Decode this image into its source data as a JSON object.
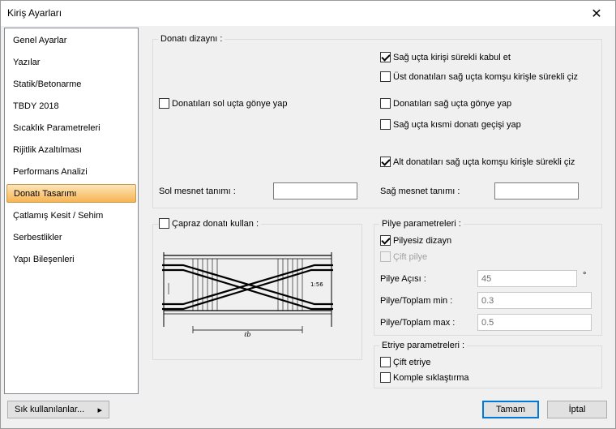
{
  "window": {
    "title": "Kiriş Ayarları"
  },
  "sidebar": {
    "items": [
      {
        "label": "Genel Ayarlar",
        "selected": false
      },
      {
        "label": "Yazılar",
        "selected": false
      },
      {
        "label": "Statik/Betonarme",
        "selected": false
      },
      {
        "label": "TBDY 2018",
        "selected": false
      },
      {
        "label": "Sıcaklık Parametreleri",
        "selected": false
      },
      {
        "label": "Rijitlik Azaltılması",
        "selected": false
      },
      {
        "label": "Performans Analizi",
        "selected": false
      },
      {
        "label": "Donatı Tasarımı",
        "selected": true
      },
      {
        "label": "Çatlamış Kesit / Sehim",
        "selected": false
      },
      {
        "label": "Serbestlikler",
        "selected": false
      },
      {
        "label": "Yapı Bileşenleri",
        "selected": false
      }
    ]
  },
  "donati_dizayni": {
    "title": "Donatı dizaynı :",
    "sag_kirisi_surekli": {
      "label": "Sağ uçta kirişi sürekli kabul et",
      "checked": true
    },
    "ust_donati_komsu": {
      "label": "Üst donatıları sağ uçta komşu kirişle sürekli çiz",
      "checked": false
    },
    "sol_gonye": {
      "label": "Donatıları sol uçta gönye yap",
      "checked": false
    },
    "sag_gonye": {
      "label": "Donatıları sağ uçta gönye yap",
      "checked": false
    },
    "sag_kismi_gecis": {
      "label": "Sağ uçta kısmi donatı geçişi yap",
      "checked": false
    },
    "alt_donati_komsu": {
      "label": "Alt donatıları sağ uçta komşu kirişle sürekli çiz",
      "checked": true
    },
    "sol_mesnet_label": "Sol mesnet tanımı :",
    "sol_mesnet_value": "",
    "sag_mesnet_label": "Sağ mesnet tanımı :",
    "sag_mesnet_value": ""
  },
  "capraz": {
    "label": "Çapraz donatı kullan :",
    "checked": false,
    "diagram_labels": {
      "angle": "1:56",
      "length": "ℓb"
    }
  },
  "pilye": {
    "title": "Pilye parametreleri :",
    "pilyesiz": {
      "label": "Pilyesiz dizayn",
      "checked": true
    },
    "cift_pilye": {
      "label": "Çift pilye",
      "checked": false,
      "disabled": true
    },
    "aci_label": "Pilye Açısı :",
    "aci_value": "45",
    "aci_unit": "°",
    "toplam_min_label": "Pilye/Toplam min :",
    "toplam_min_value": "0.3",
    "toplam_max_label": "Pilye/Toplam max :",
    "toplam_max_value": "0.5"
  },
  "etriye": {
    "title": "Etriye parametreleri :",
    "cift_etriye": {
      "label": "Çift etriye",
      "checked": false
    },
    "komple": {
      "label": "Komple sıklaştırma",
      "checked": false
    }
  },
  "footer": {
    "frequent_label": "Sık kullanılanlar...",
    "frequent_arrow": "▸",
    "ok_label": "Tamam",
    "cancel_label": "İptal"
  }
}
